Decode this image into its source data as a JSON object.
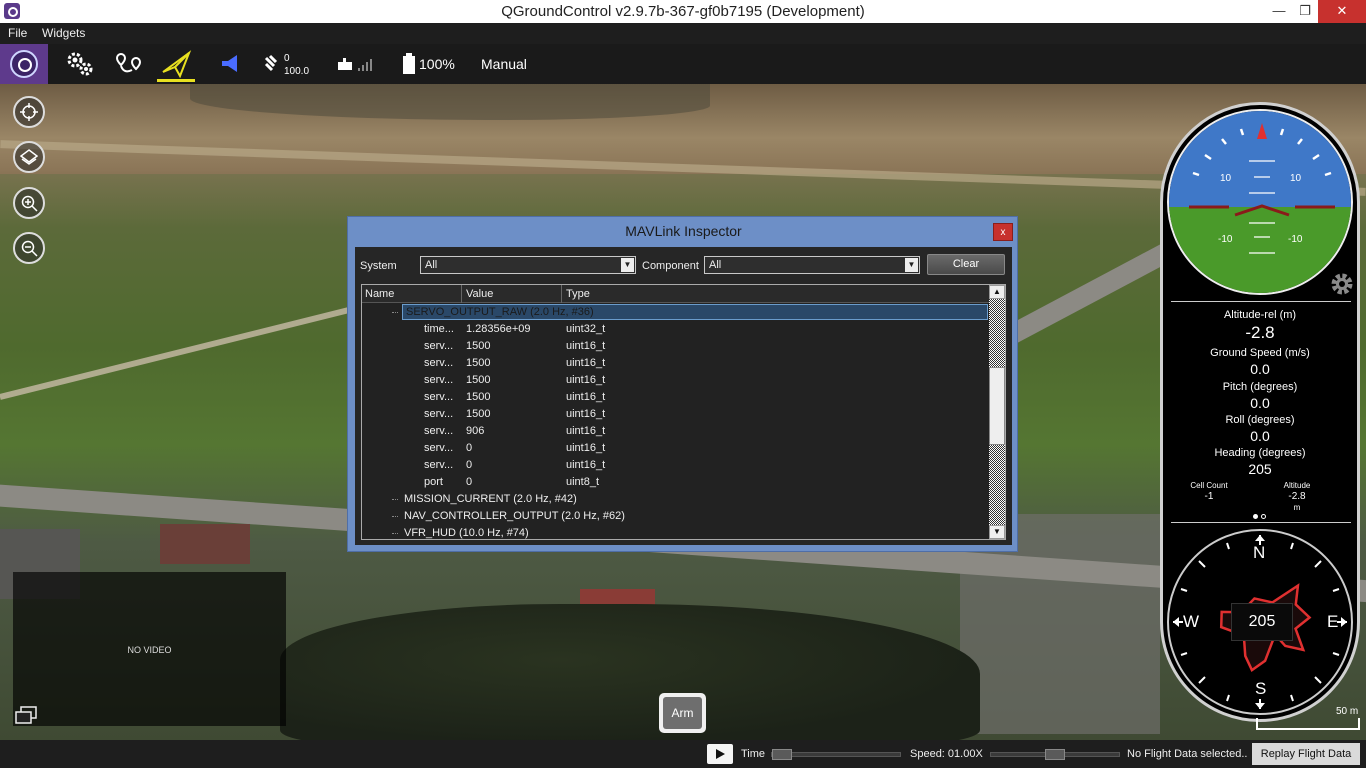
{
  "window": {
    "title": "QGroundControl v2.9.7b-367-gf0b7195 (Development)",
    "minimize": "—",
    "maximize": "❐",
    "close": "✕"
  },
  "menu": [
    "File",
    "Widgets"
  ],
  "toolbar": {
    "gps_satellites": "0",
    "gps_hdop": "100.0",
    "battery": "100%",
    "flight_mode": "Manual"
  },
  "inspector": {
    "title": "MAVLink Inspector",
    "close": "x",
    "system_label": "System",
    "system_value": "All",
    "component_label": "Component",
    "component_value": "All",
    "clear_label": "Clear",
    "columns": [
      "Name",
      "Value",
      "Type"
    ],
    "selected": "SERVO_OUTPUT_RAW (2.0 Hz, #36)",
    "fields": [
      {
        "name": "time...",
        "value": "1.28356e+09",
        "type": "uint32_t"
      },
      {
        "name": "serv...",
        "value": "1500",
        "type": "uint16_t"
      },
      {
        "name": "serv...",
        "value": "1500",
        "type": "uint16_t"
      },
      {
        "name": "serv...",
        "value": "1500",
        "type": "uint16_t"
      },
      {
        "name": "serv...",
        "value": "1500",
        "type": "uint16_t"
      },
      {
        "name": "serv...",
        "value": "1500",
        "type": "uint16_t"
      },
      {
        "name": "serv...",
        "value": "906",
        "type": "uint16_t"
      },
      {
        "name": "serv...",
        "value": "0",
        "type": "uint16_t"
      },
      {
        "name": "serv...",
        "value": "0",
        "type": "uint16_t"
      },
      {
        "name": "port",
        "value": "0",
        "type": "uint8_t"
      }
    ],
    "messages": [
      "MISSION_CURRENT (2.0 Hz, #42)",
      "NAV_CONTROLLER_OUTPUT (2.0 Hz, #62)",
      "VFR_HUD (10.0 Hz, #74)"
    ]
  },
  "instrument": {
    "pitch_labels": [
      "10",
      "10",
      "-10",
      "-10"
    ],
    "alt_label": "Altitude-rel (m)",
    "alt_value": "-2.8",
    "gs_label": "Ground Speed (m/s)",
    "gs_value": "0.0",
    "pitch_label": "Pitch (degrees)",
    "pitch_value": "0.0",
    "roll_label": "Roll (degrees)",
    "roll_value": "0.0",
    "heading_label": "Heading (degrees)",
    "heading_value": "205",
    "cell_label": "Cell Count",
    "cell_value": "-1",
    "alt2_label": "Altitude",
    "alt2_value": "-2.8",
    "alt2_unit": "m",
    "compass": {
      "n": "N",
      "s": "S",
      "e": "E",
      "w": "W",
      "heading": "205"
    },
    "scale": "50 m"
  },
  "video": {
    "label": "NO VIDEO"
  },
  "arm_label": "Arm",
  "statusbar": {
    "time_label": "Time",
    "speed_label": "Speed: 01.00X",
    "no_data": "No Flight Data selected..",
    "replay_label": "Replay Flight Data"
  },
  "colors": {
    "accent": "#5e3a8c",
    "plan_underline": "#e8e020",
    "dialog_frame": "#6d8fc7",
    "sky": "#3f78c8",
    "ground": "#4a9a2a",
    "close_red": "#c7312e"
  }
}
